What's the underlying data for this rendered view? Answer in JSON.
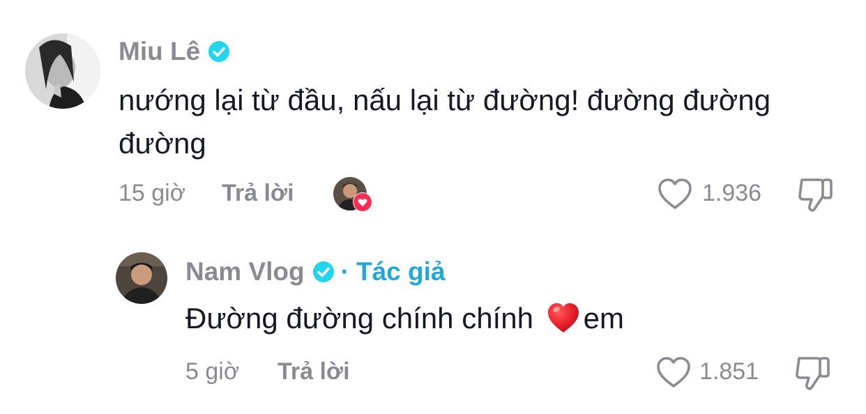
{
  "comments": [
    {
      "username": "Miu Lê",
      "verified": true,
      "text": "nướng lại từ đầu, nấu lại từ đường! đường đường đường",
      "time": "15 giờ",
      "reply_label": "Trả lời",
      "likes": "1.936",
      "creator_liked": true
    }
  ],
  "reply": {
    "username": "Nam Vlog",
    "verified": true,
    "separator": "·",
    "author_label": "Tác giả",
    "text_before": "Đường đường chính chính",
    "emoji": "heart-emoji",
    "text_after": "em",
    "time": "5 giờ",
    "reply_label": "Trả lời",
    "likes": "1.851"
  },
  "colors": {
    "muted": "#8a8b91",
    "text": "#161823",
    "verified": "#20d5ec",
    "author_tag": "#20a8d6",
    "like_heart": "#fe2c55"
  }
}
